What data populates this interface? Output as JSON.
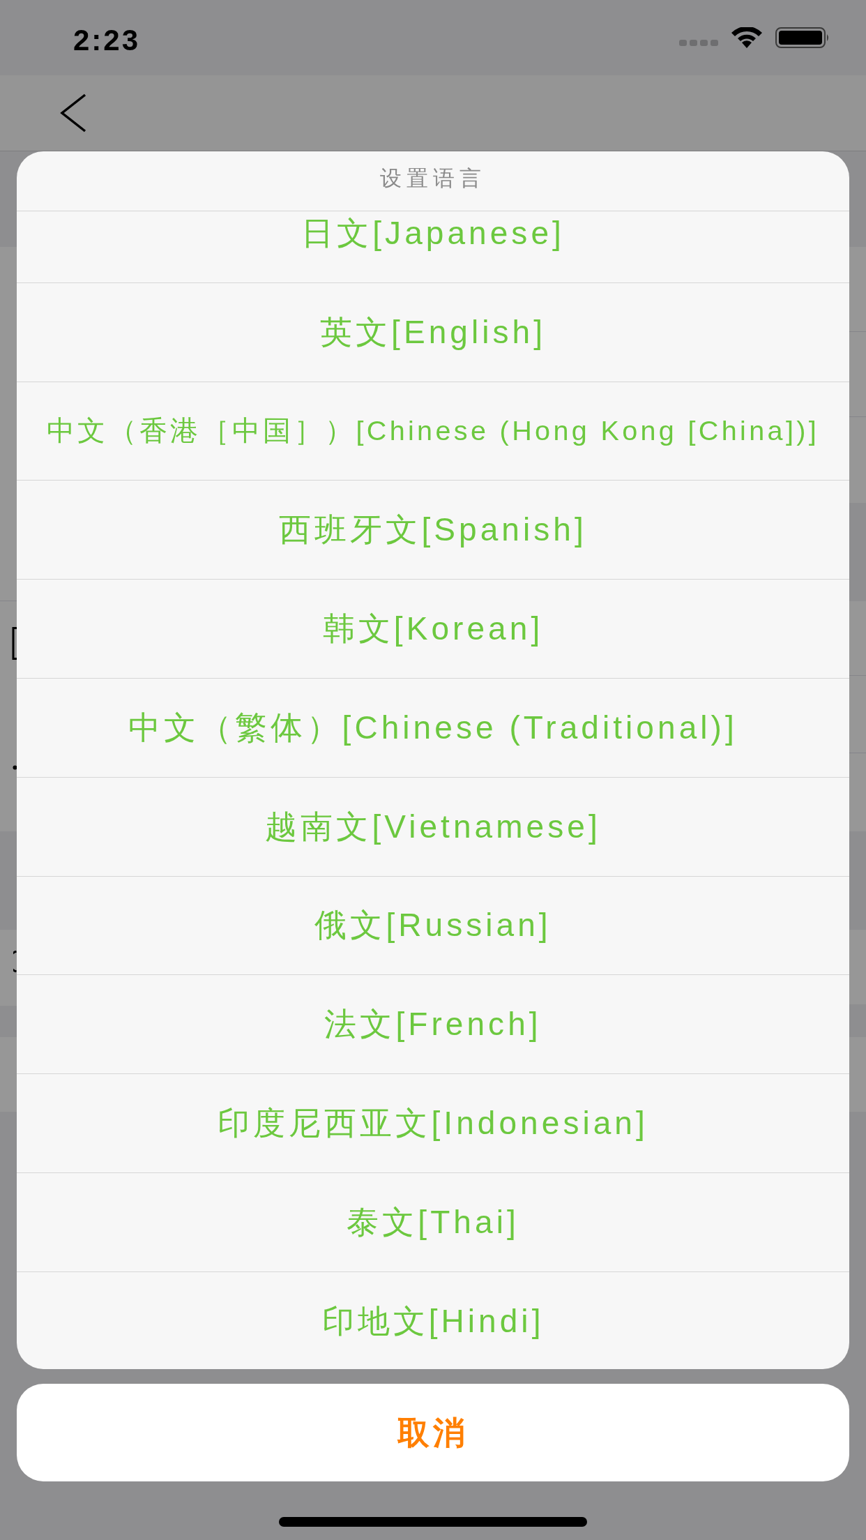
{
  "status_bar": {
    "time": "2:23"
  },
  "action_sheet": {
    "title": "设置语言",
    "options": [
      "日文[Japanese]",
      "英文[English]",
      "中文（香港［中国］）[Chinese (Hong Kong [China])]",
      "西班牙文[Spanish]",
      "韩文[Korean]",
      "中文（繁体）[Chinese (Traditional)]",
      "越南文[Vietnamese]",
      "俄文[Russian]",
      "法文[French]",
      "印度尼西亚文[Indonesian]",
      "泰文[Thai]",
      "印地文[Hindi]"
    ],
    "cancel_button": "取消"
  }
}
